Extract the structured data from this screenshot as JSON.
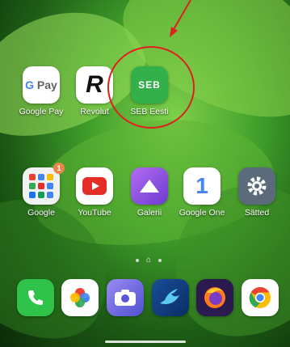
{
  "apps_row1": [
    {
      "label": "Google Pay",
      "icon": "google-pay-icon"
    },
    {
      "label": "Revolut",
      "icon": "revolut-icon"
    },
    {
      "label": "SEB Eesti",
      "icon": "seb-icon",
      "icon_text": "SEB"
    }
  ],
  "apps_row2": [
    {
      "label": "Google",
      "icon": "google-folder-icon",
      "badge": "1"
    },
    {
      "label": "YouTube",
      "icon": "youtube-icon"
    },
    {
      "label": "Galerii",
      "icon": "gallery-icon"
    },
    {
      "label": "Google One",
      "icon": "google-one-icon",
      "icon_text": "1"
    },
    {
      "label": "Sätted",
      "icon": "settings-icon"
    }
  ],
  "dock": [
    {
      "icon": "phone-icon"
    },
    {
      "icon": "photos-icon"
    },
    {
      "icon": "camera-icon"
    },
    {
      "icon": "messenger-bird-icon"
    },
    {
      "icon": "firefox-icon"
    },
    {
      "icon": "chrome-icon"
    }
  ],
  "pager": {
    "home_glyph": "⌂"
  },
  "annotation": {
    "color": "#e02020"
  },
  "colors": {
    "seb_green": "#34b04a",
    "youtube_red": "#e52d27",
    "gallery_purple": "#8a4fd6"
  }
}
